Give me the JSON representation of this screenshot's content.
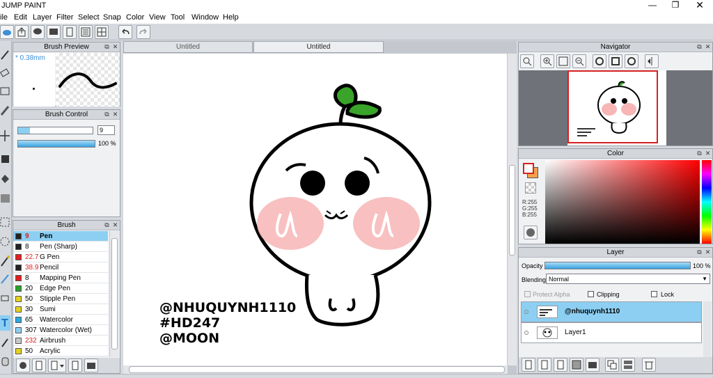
{
  "app": {
    "title": "JUMP PAINT"
  },
  "menu": [
    "ile",
    "Edit",
    "Layer",
    "Filter",
    "Select",
    "Snap",
    "Color",
    "View",
    "Tool",
    "Window",
    "Help"
  ],
  "tabs": [
    "Untitled",
    "Untitled"
  ],
  "brush_preview": {
    "title": "Brush Preview",
    "size": "* 0.38mm"
  },
  "brush_control": {
    "title": "Brush Control",
    "size_value": "9",
    "opacity_value": "100 %"
  },
  "brush_list": {
    "title": "Brush",
    "items": [
      {
        "size": "9",
        "size_color": "#d62020",
        "name": "Pen",
        "swatch": "#222222",
        "selected": true
      },
      {
        "size": "8",
        "size_color": "#000000",
        "name": "Pen (Sharp)",
        "swatch": "#222222"
      },
      {
        "size": "22.7",
        "size_color": "#d62020",
        "name": "G Pen",
        "swatch": "#e02020"
      },
      {
        "size": "38.9",
        "size_color": "#d62020",
        "name": "Pencil",
        "swatch": "#222222"
      },
      {
        "size": "8",
        "size_color": "#000000",
        "name": "Mapping Pen",
        "swatch": "#e02020"
      },
      {
        "size": "20",
        "size_color": "#000000",
        "name": "Edge Pen",
        "swatch": "#2aa02a"
      },
      {
        "size": "50",
        "size_color": "#000000",
        "name": "Stipple Pen",
        "swatch": "#e6d21e"
      },
      {
        "size": "30",
        "size_color": "#000000",
        "name": "Sumi",
        "swatch": "#e6d21e"
      },
      {
        "size": "65",
        "size_color": "#000000",
        "name": "Watercolor",
        "swatch": "#2aa9e0"
      },
      {
        "size": "307",
        "size_color": "#000000",
        "name": "Watercolor (Wet)",
        "swatch": "#8ccff2"
      },
      {
        "size": "232",
        "size_color": "#d62020",
        "name": "Airbrush",
        "swatch": "#c8c8c8"
      },
      {
        "size": "50",
        "size_color": "#000000",
        "name": "Acrylic",
        "swatch": "#e6d21e"
      }
    ]
  },
  "navigator": {
    "title": "Navigator"
  },
  "color_panel": {
    "title": "Color",
    "r": "R:255",
    "g": "G:255",
    "b": "B:255"
  },
  "layer_panel": {
    "title": "Layer",
    "opacity_label": "Opacity",
    "opacity_value": "100 %",
    "blending_label": "Blending",
    "blending_value": "Normal",
    "protect_alpha": "Protect Alpha",
    "clipping": "Clipping",
    "lock": "Lock",
    "layers": [
      {
        "name": "@nhuquynh1110",
        "selected": true
      },
      {
        "name": "Layer1",
        "selected": false
      }
    ]
  },
  "canvas_text": {
    "line1": "@NHUQUYNH1110",
    "line2": "#HD247",
    "line3": "@MOON"
  },
  "colors": {
    "accent": "#8ccff2",
    "panel": "#f0f1f3",
    "leaf": "#3aa32a",
    "blush": "#f7b5b5"
  }
}
